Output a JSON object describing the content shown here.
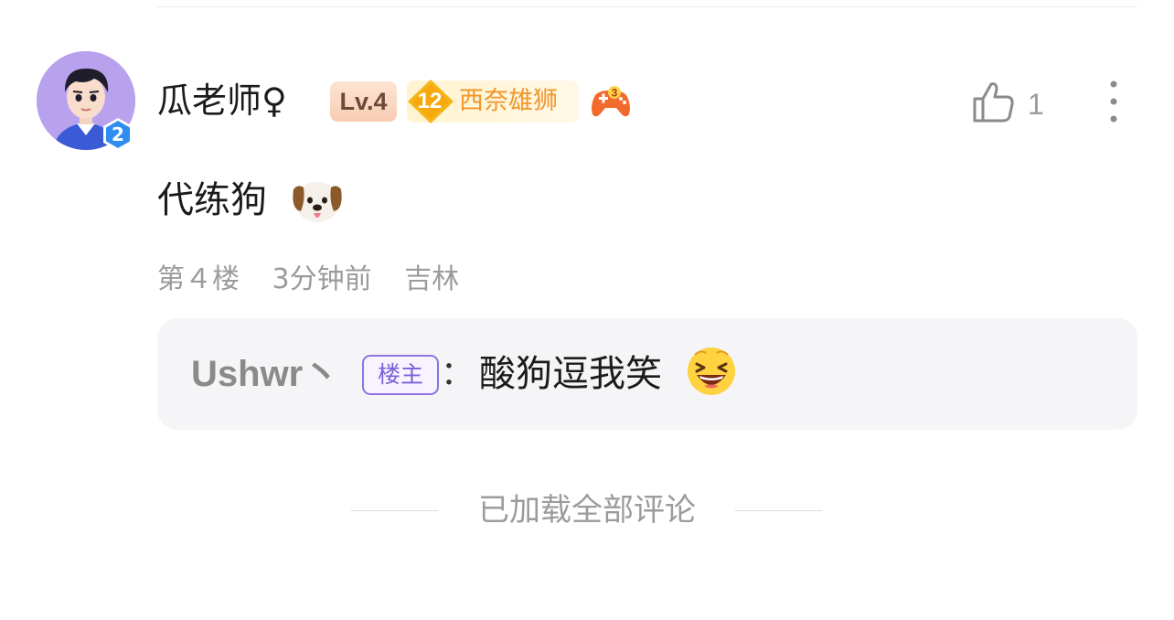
{
  "comment": {
    "avatar_badge_level": "2",
    "username": "瓜老师♀",
    "level_badge": "Lv.4",
    "fan_badge": {
      "level": "12",
      "name": "西奈雄狮"
    },
    "game_icon": "game-controller-badge-3",
    "like_icon": "thumbs-up-icon",
    "like_count": "1",
    "more_icon": "more-vertical-icon",
    "text": "代练狗",
    "text_emoji": "dog-face-emoji",
    "meta": {
      "floor": "第４楼",
      "time": "3分钟前",
      "location": "吉林"
    },
    "reply": {
      "user": "Ushwr丶",
      "op_badge": "楼主",
      "colon": "：",
      "text": "酸狗逗我笑",
      "emoji": "grinning-squinting-emoji"
    }
  },
  "footer": {
    "loaded_all": "已加载全部评论"
  },
  "colors": {
    "avatar_bg": "#b8a2ee",
    "level_badge_bg": "#f7cdb2",
    "fan_badge_bg": "#fff4cf",
    "fan_name": "#f0962a",
    "op_badge": "#8e74e0",
    "reply_bg": "#f5f5f7",
    "meta_text": "#9b9b9b"
  }
}
